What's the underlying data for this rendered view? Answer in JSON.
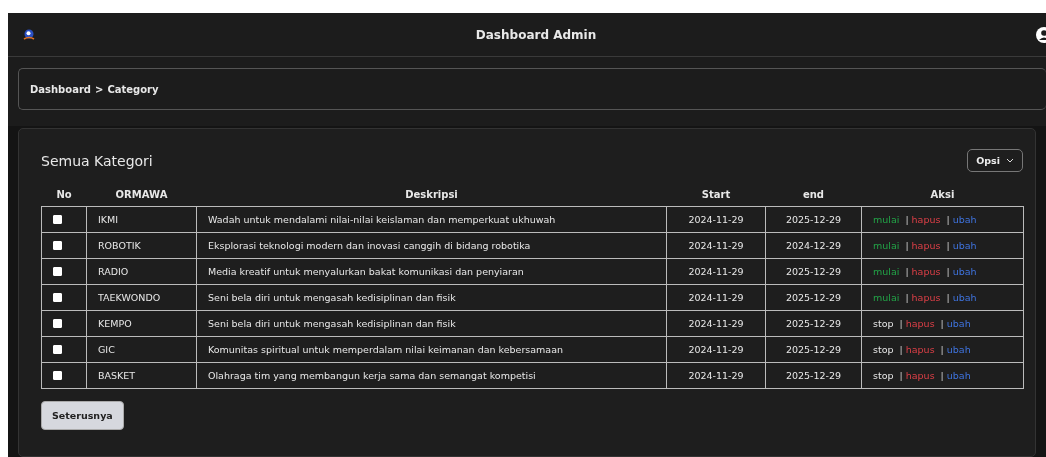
{
  "header": {
    "title": "Dashboard Admin"
  },
  "breadcrumb": [
    {
      "label": "Dashboard"
    },
    {
      "label": ">"
    },
    {
      "label": "Category"
    }
  ],
  "card": {
    "title": "Semua Kategori",
    "options_button": "Opsi"
  },
  "table": {
    "columns": [
      "No",
      "ORMAWA",
      "Deskripsi",
      "Start",
      "end",
      "Aksi"
    ],
    "rows": [
      {
        "checked": false,
        "ormawa": "IKMI",
        "deskripsi": "Wadah untuk mendalami nilai-nilai keislaman dan memperkuat ukhuwah",
        "start": "2024-11-29",
        "end": "2025-12-29",
        "actions": [
          {
            "kind": "start",
            "label": "mulai"
          },
          {
            "kind": "separator",
            "label": "|"
          },
          {
            "kind": "delete",
            "label": "hapus"
          },
          {
            "kind": "separator",
            "label": "|"
          },
          {
            "kind": "edit",
            "label": "ubah"
          }
        ]
      },
      {
        "checked": false,
        "ormawa": "ROBOTIK",
        "deskripsi": "Eksplorasi teknologi modern dan inovasi canggih di bidang robotika",
        "start": "2024-11-29",
        "end": "2024-12-29",
        "actions": [
          {
            "kind": "start",
            "label": "mulai"
          },
          {
            "kind": "separator",
            "label": "|"
          },
          {
            "kind": "delete",
            "label": "hapus"
          },
          {
            "kind": "separator",
            "label": "|"
          },
          {
            "kind": "edit",
            "label": "ubah"
          }
        ]
      },
      {
        "checked": false,
        "ormawa": "RADIO",
        "deskripsi": "Media kreatif untuk menyalurkan bakat komunikasi dan penyiaran",
        "start": "2024-11-29",
        "end": "2025-12-29",
        "actions": [
          {
            "kind": "start",
            "label": "mulai"
          },
          {
            "kind": "separator",
            "label": "|"
          },
          {
            "kind": "delete",
            "label": "hapus"
          },
          {
            "kind": "separator",
            "label": "|"
          },
          {
            "kind": "edit",
            "label": "ubah"
          }
        ]
      },
      {
        "checked": false,
        "ormawa": "TAEKWONDO",
        "deskripsi": "Seni bela diri untuk mengasah kedisiplinan dan fisik",
        "start": "2024-11-29",
        "end": "2025-12-29",
        "actions": [
          {
            "kind": "start",
            "label": "mulai"
          },
          {
            "kind": "separator",
            "label": "|"
          },
          {
            "kind": "delete",
            "label": "hapus"
          },
          {
            "kind": "separator",
            "label": "|"
          },
          {
            "kind": "edit",
            "label": "ubah"
          }
        ]
      },
      {
        "checked": false,
        "ormawa": "KEMPO",
        "deskripsi": "Seni bela diri untuk mengasah kedisiplinan dan fisik",
        "start": "2024-11-29",
        "end": "2025-12-29",
        "actions": [
          {
            "kind": "stop",
            "label": "stop"
          },
          {
            "kind": "separator",
            "label": "|"
          },
          {
            "kind": "delete",
            "label": "hapus"
          },
          {
            "kind": "separator",
            "label": "|"
          },
          {
            "kind": "edit",
            "label": "ubah"
          }
        ]
      },
      {
        "checked": false,
        "ormawa": "GIC",
        "deskripsi": "Komunitas spiritual untuk memperdalam nilai keimanan dan kebersamaan",
        "start": "2024-11-29",
        "end": "2025-12-29",
        "actions": [
          {
            "kind": "stop",
            "label": "stop"
          },
          {
            "kind": "separator",
            "label": "|"
          },
          {
            "kind": "delete",
            "label": "hapus"
          },
          {
            "kind": "separator",
            "label": "|"
          },
          {
            "kind": "edit",
            "label": "ubah"
          }
        ]
      },
      {
        "checked": false,
        "ormawa": "BASKET",
        "deskripsi": "Olahraga tim yang membangun kerja sama dan semangat kompetisi",
        "start": "2024-11-29",
        "end": "2025-12-29",
        "actions": [
          {
            "kind": "stop",
            "label": "stop"
          },
          {
            "kind": "separator",
            "label": "|"
          },
          {
            "kind": "delete",
            "label": "hapus"
          },
          {
            "kind": "separator",
            "label": "|"
          },
          {
            "kind": "edit",
            "label": "ubah"
          }
        ]
      }
    ]
  },
  "next_button": "Seterusnya"
}
